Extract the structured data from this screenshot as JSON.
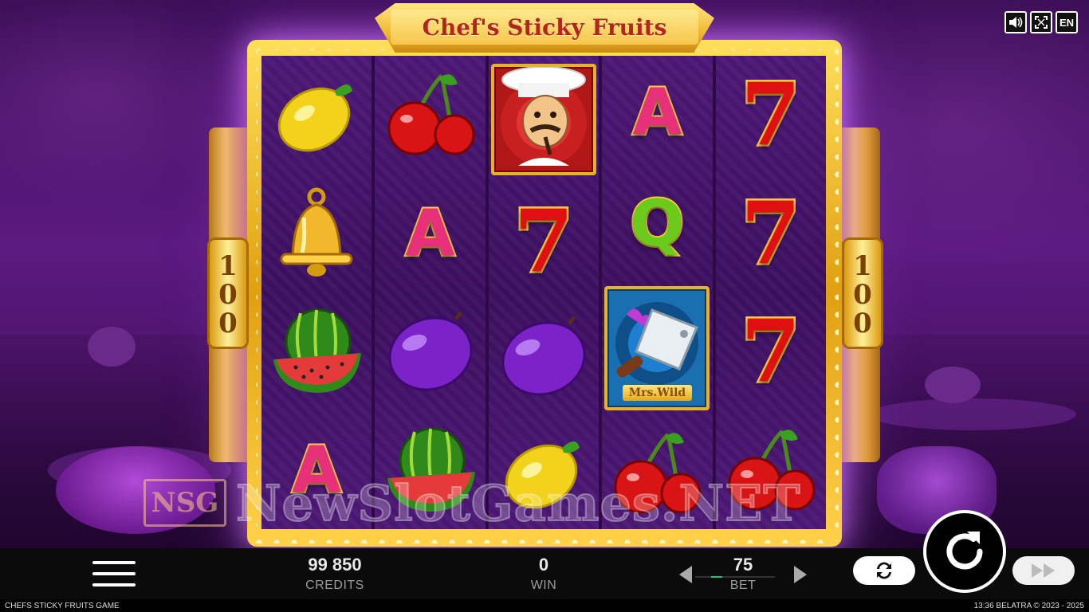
{
  "game": {
    "title": "Chef's Sticky Fruits",
    "side_value": "100",
    "wild_label": "Mrs.Wild"
  },
  "reels": [
    [
      "lemon",
      "bell",
      "watermelon",
      "A"
    ],
    [
      "cherries",
      "A",
      "plum",
      "watermelon"
    ],
    [
      "chef",
      "7",
      "plum",
      "lemon"
    ],
    [
      "A",
      "Q",
      "mrs-wild",
      "cherries"
    ],
    [
      "7",
      "7",
      "7",
      "cherries"
    ]
  ],
  "top_controls": {
    "sound_icon": "speaker-icon",
    "fullscreen_icon": "fullscreen-icon",
    "language": "EN"
  },
  "bottom_bar": {
    "credits_value": "99 850",
    "credits_label": "CREDITS",
    "win_value": "0",
    "win_label": "WIN",
    "bet_value": "75",
    "bet_label": "BET"
  },
  "watermark": {
    "logo": "NSG",
    "text": "NewSlotGames.NET"
  },
  "footer": {
    "left": "CHEFS STICKY FRUITS GAME",
    "right": "13:36  BELATRA © 2023 - 2025"
  },
  "colors": {
    "background": "#5b1a80",
    "frame_gold": "#ffd24a",
    "title_red": "#b3261e",
    "bar": "#0b0b0b",
    "accent_green": "#22c07a"
  }
}
